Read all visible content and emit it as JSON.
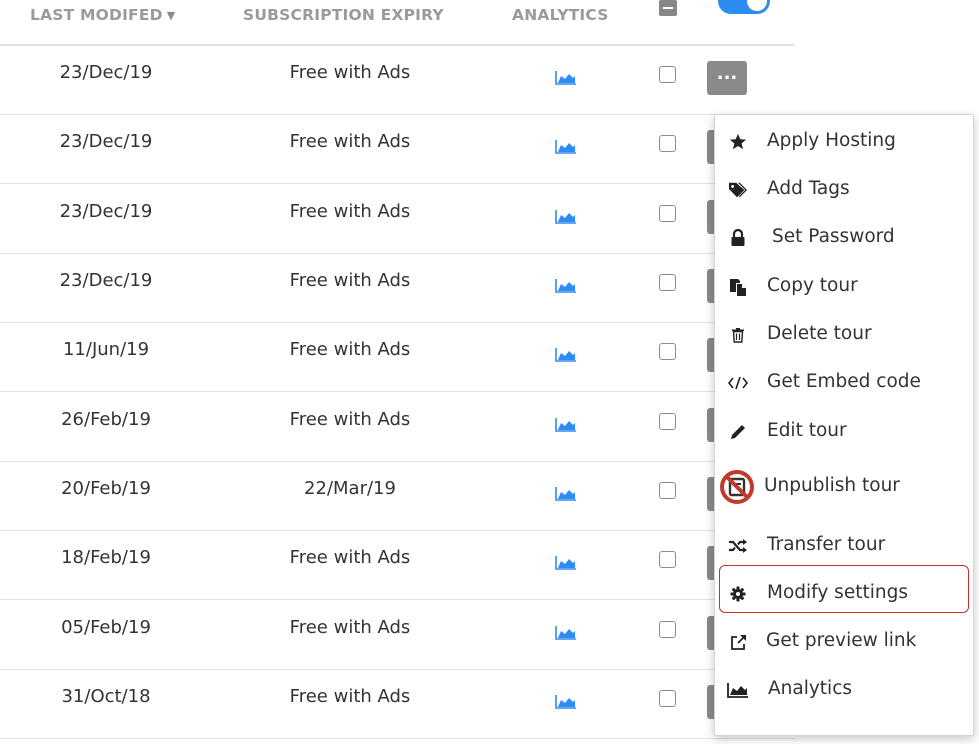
{
  "header": {
    "last_modified": "LAST MODIFED",
    "subscription_expiry": "SUBSCRIPTION EXPIRY",
    "analytics": "ANALYTICS"
  },
  "rows": [
    {
      "modified": "23/Dec/19",
      "expiry": "Free with Ads"
    },
    {
      "modified": "23/Dec/19",
      "expiry": "Free with Ads"
    },
    {
      "modified": "23/Dec/19",
      "expiry": "Free with Ads"
    },
    {
      "modified": "23/Dec/19",
      "expiry": "Free with Ads"
    },
    {
      "modified": "11/Jun/19",
      "expiry": "Free with Ads"
    },
    {
      "modified": "26/Feb/19",
      "expiry": "Free with Ads"
    },
    {
      "modified": "20/Feb/19",
      "expiry": "22/Mar/19"
    },
    {
      "modified": "18/Feb/19",
      "expiry": "Free with Ads"
    },
    {
      "modified": "05/Feb/19",
      "expiry": "Free with Ads"
    },
    {
      "modified": "31/Oct/18",
      "expiry": "Free with Ads"
    }
  ],
  "more_button_label": "...",
  "menu": {
    "items": [
      {
        "label": "Apply Hosting",
        "icon": "star-icon"
      },
      {
        "label": "Add Tags",
        "icon": "tags-icon"
      },
      {
        "label": "Set Password",
        "icon": "lock-icon"
      },
      {
        "label": "Copy tour",
        "icon": "copy-icon"
      },
      {
        "label": "Delete tour",
        "icon": "trash-icon"
      },
      {
        "label": "Get Embed code",
        "icon": "code-icon"
      },
      {
        "label": "Edit tour",
        "icon": "pencil-icon"
      },
      {
        "label": "Unpublish tour",
        "icon": "unpublish-icon"
      },
      {
        "label": "Transfer tour",
        "icon": "shuffle-icon"
      },
      {
        "label": "Modify settings",
        "icon": "gear-icon"
      },
      {
        "label": "Get preview link",
        "icon": "external-link-icon"
      },
      {
        "label": "Analytics",
        "icon": "area-chart-icon"
      }
    ],
    "highlighted": "Modify settings"
  },
  "colors": {
    "accent": "#2d8cf0",
    "analytics_icon": "#2d8cf0",
    "highlight": "#c9302c",
    "button_gray": "#8a8a8a"
  }
}
